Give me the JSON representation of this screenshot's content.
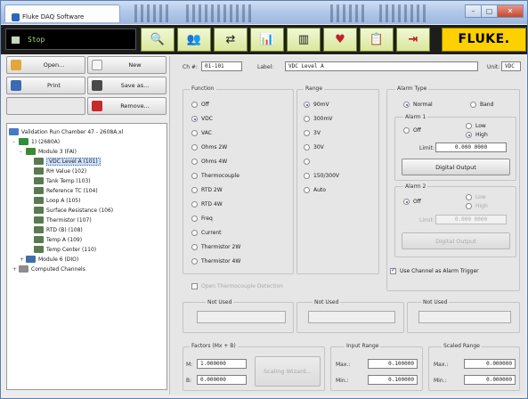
{
  "window": {
    "title": "Fluke DAQ Software",
    "controls": [
      "–",
      "▢",
      "✕"
    ]
  },
  "toolbar": {
    "display_text": "Stop",
    "brand": "FLUKE.",
    "buttons": [
      {
        "name": "search-button",
        "icon": "magnifier-icon",
        "glyph": "🔍"
      },
      {
        "name": "instrument-button",
        "icon": "people-icon",
        "glyph": "👥"
      },
      {
        "name": "network-button",
        "icon": "network-icon",
        "glyph": "⇄"
      },
      {
        "name": "scan-button",
        "icon": "chart-people-icon",
        "glyph": "📊"
      },
      {
        "name": "trend-button",
        "icon": "bar-chart-icon",
        "glyph": "▥"
      },
      {
        "name": "alarm-button",
        "icon": "heart-chart-icon",
        "glyph": "♥"
      },
      {
        "name": "report-button",
        "icon": "report-icon",
        "glyph": "📋"
      },
      {
        "name": "exit-button",
        "icon": "exit-icon",
        "glyph": "⇥"
      }
    ]
  },
  "left_buttons": {
    "open": "Open...",
    "new": "New",
    "print": "Print",
    "save_as": "Save as...",
    "remove": "Remove..."
  },
  "tree": {
    "items": [
      {
        "label": "Validation Run Chamber 47 - 2608A.xl",
        "icon": "computer-icon",
        "level": 0,
        "expander": ""
      },
      {
        "label": "1) (2680A)",
        "icon": "device-icon",
        "level": 1,
        "expander": "–"
      },
      {
        "label": "Module 3 (FAI)",
        "icon": "module-icon",
        "level": 2,
        "expander": "–"
      },
      {
        "label": "VDC Level A (101)",
        "icon": "channel-icon",
        "level": 3,
        "expander": "",
        "selected": true
      },
      {
        "label": "RH Value (102)",
        "icon": "channel-icon",
        "level": 3,
        "expander": ""
      },
      {
        "label": "Tank Temp (103)",
        "icon": "channel-icon",
        "level": 3,
        "expander": ""
      },
      {
        "label": "Reference TC (104)",
        "icon": "channel-icon",
        "level": 3,
        "expander": ""
      },
      {
        "label": "Loop A (105)",
        "icon": "channel-icon",
        "level": 3,
        "expander": ""
      },
      {
        "label": "Surface Resistance (106)",
        "icon": "channel-icon",
        "level": 3,
        "expander": ""
      },
      {
        "label": "Thermistor (107)",
        "icon": "channel-icon",
        "level": 3,
        "expander": ""
      },
      {
        "label": "RTD (B) (108)",
        "icon": "channel-icon",
        "level": 3,
        "expander": ""
      },
      {
        "label": "Temp A (109)",
        "icon": "channel-icon",
        "level": 3,
        "expander": ""
      },
      {
        "label": "Temp Center (110)",
        "icon": "channel-icon",
        "level": 3,
        "expander": ""
      },
      {
        "label": "Module 6 (DIO)",
        "icon": "module-icon",
        "level": 2,
        "expander": "+"
      },
      {
        "label": "Computed Channels",
        "icon": "computed-icon",
        "level": 1,
        "expander": "+"
      }
    ]
  },
  "channel": {
    "ch_label": "Ch #:",
    "ch_value": "01-101",
    "label_label": "Label:",
    "label_value": "VDC Level A",
    "unit_label": "Unit:",
    "unit_value": "VDC"
  },
  "function": {
    "title": "Function",
    "options": [
      "Off",
      "VDC",
      "VAC",
      "Ohms 2W",
      "Ohms 4W",
      "Thermocouple",
      "RTD 2W",
      "RTD 4W",
      "Freq",
      "Current",
      "Thermistor 2W",
      "Thermistor 4W"
    ],
    "selected": "VDC"
  },
  "range": {
    "title": "Range",
    "options": [
      "90mV",
      "300mV",
      "3V",
      "30V",
      "",
      "150/300V",
      "Auto"
    ],
    "selected": "90mV"
  },
  "alarm_type": {
    "title": "Alarm Type",
    "options": [
      "Normal",
      "Band"
    ],
    "selected": "Normal"
  },
  "alarm1": {
    "title": "Alarm 1",
    "off": "Off",
    "low": "Low",
    "high": "High",
    "limit_label": "Limit:",
    "limit_value": "0.000 0000",
    "output_button": "Digital Output"
  },
  "alarm2": {
    "title": "Alarm 2",
    "off": "Off",
    "low": "Low",
    "high": "High",
    "limit_label": "Limit:",
    "limit_value": "0.000 0000",
    "output_button": "Digital Output"
  },
  "trigger": {
    "label": "Use Channel as Alarm Trigger",
    "checked": true
  },
  "faint_checkbox": {
    "label": "Open Thermocouple Detection"
  },
  "not_used": [
    "Not Used",
    "Not Used",
    "Not Used"
  ],
  "factors": {
    "title": "Factors (Mx + B)",
    "m_label": "M:",
    "m_value": "1.000000",
    "b_label": "B:",
    "b_value": "0.000000",
    "scaling_button": "Scaling Wizard..."
  },
  "input_range": {
    "title": "Input Range",
    "max_label": "Max.:",
    "max_value": "0.100000",
    "min_label": "Min.:",
    "min_value": "0.100000"
  },
  "scaled_range": {
    "title": "Scaled Range",
    "max_label": "Max.:",
    "max_value": "0.000000",
    "min_label": "Min.:",
    "min_value": "0.000000"
  }
}
